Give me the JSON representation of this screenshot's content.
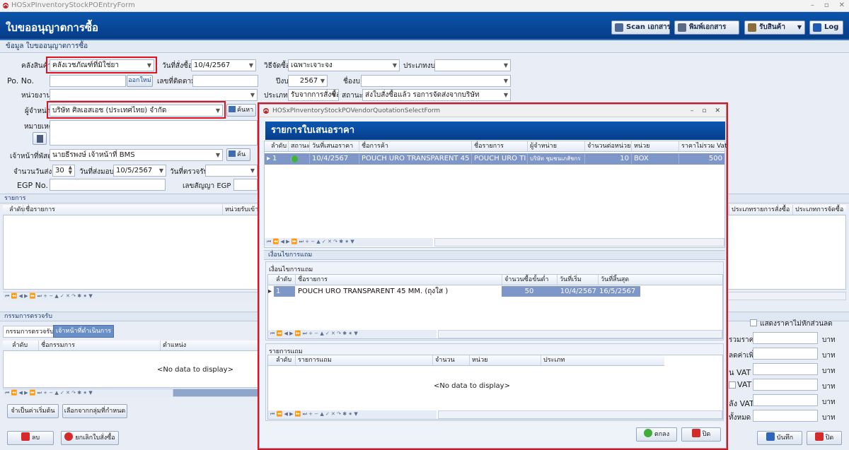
{
  "window": {
    "title": "HOSxPInventoryStockPOEntryForm",
    "btn_min": "–",
    "btn_max": "▫",
    "btn_close": "✕"
  },
  "header": {
    "title": "ใบขออนุญาตการซื้อ",
    "buttons": [
      {
        "label": "Scan เอกสาร"
      },
      {
        "label": "พิมพ์เอกสาร"
      },
      {
        "label": "รับสินค้า"
      },
      {
        "label": "Log"
      }
    ]
  },
  "subtab": "ข้อมูล ใบขออนุญาตการซื้อ",
  "form": {
    "warehouse_label": "คลังสินค้า",
    "warehouse_value": "คลังเวชภัณฑ์ที่มิใช่ยา",
    "order_date_label": "วันที่สั่งซื้อ",
    "order_date_value": "10/4/2567",
    "method_label": "วิธีจัดซื้อ",
    "method_value": "เฉพาะเจาะจง",
    "budget_type_label": "ประเภทงบ",
    "budget_type_value": "",
    "po_label": "Po. No.",
    "new_btn": "ออกใหม่",
    "track_label": "เลขที่ติดตาม",
    "year_label": "ปีงบ",
    "year_value": "2567",
    "budget_name_label": "ชื่องบ",
    "dept_label": "หน่วยงาน",
    "type_label": "ประเภท",
    "type_value": "รับจากการสั่งซื้อ",
    "status_label": "สถานะ",
    "status_value": "ส่งใบสั่งซื้อแล้ว รอการจัดส่งจากบริษัท",
    "vendor_label": "ผู้จำหน่าย",
    "vendor_value": "บริษัท ศิลเอสเอช (ประเทศไทย) จำกัด",
    "vendor_search": "ค้นหา",
    "remark_label": "หมายเหตุ",
    "officer_label": "เจ้าหน้าที่พัสดุ",
    "officer_value": "นายธีรพงษ์ เจ้าหน้าที่ BMS",
    "officer_search": "ค้น",
    "days_label": "จำนวนวันส่ง",
    "days_value": "30",
    "deliver_label": "วันที่ส่งมอบ",
    "deliver_value": "10/5/2567",
    "inspect_label": "วันที่ตรวจรับ",
    "egp_label": "EGP No.",
    "egp_contract_label": "เลขสัญญา EGP"
  },
  "items_panel": {
    "title": "รายการ",
    "col_no": "ลำดับ",
    "col_name": "ชื่อรายการ",
    "col_unit": "หน่วยรับเข้า",
    "col_ptype": "ประเภทรายการสั่งซื้อ",
    "col_buytype": "ประเภทการจัดซื้อ"
  },
  "committee": {
    "title": "กรรมการตรวจรับ",
    "tab1": "กรรมการตรวจรับ",
    "tab2": "เจ้าหน้าที่ดำเนินการ",
    "col_no": "ลำดับ",
    "col_name": "ชื่อกรรมการ",
    "col_pos": "ตำแหน่ง",
    "nodata": "<No data to display>",
    "btn_default": "จำเป็นค่าเริ่มต้น",
    "btn_group": "เลือกจากกลุ่มที่กำหนด"
  },
  "totals": {
    "novat_check": "แสดงราคาไม่หักส่วนลด",
    "l1": "รวมราคา",
    "l2": "ลดค่าเพิ่ม",
    "l3": "น VAT",
    "l4": "VAT",
    "l5": "ลัง VAT",
    "l6": "ทั้งหมด",
    "unit": "บาท"
  },
  "footer": {
    "delete": "ลบ",
    "cancel_po": "ยกเลิกใบสั่งซื้อ",
    "save": "บันทึก",
    "close": "ปิด"
  },
  "modal": {
    "title": "HOSxPInventoryStockPOVendorQuotationSelectForm",
    "heading": "รายการใบเสนอราคา",
    "q_cols": [
      "ลำดับ",
      "สถานะ",
      "วันที่เสนอราคา",
      "ชื่อการค้า",
      "ชื่อรายการ",
      "ผู้จำหน่าย",
      "จำนวนต่อหน่วย",
      "หน่วย",
      "ราคาไม่รวม Vat"
    ],
    "q_row": {
      "no": "1",
      "date": "10/4/2567",
      "trade": "POUCH URO TRANSPARENT 45",
      "item": "POUCH URO TI",
      "vendor": "บริษัท ชุมชนเภสัชกร",
      "qty": "10",
      "unit": "BOX",
      "price": "500"
    },
    "cond_outer": "เงื่อนไขการแถม",
    "cond_inner": "เงื่อนไขการแถม",
    "c_cols": [
      "ลำดับ",
      "ชื่อรายการ",
      "จำนวนซื้อขั้นต่ำ",
      "วันที่เริ่ม",
      "วันที่สิ้นสุด"
    ],
    "c_row": {
      "no": "1",
      "name": "POUCH URO TRANSPARENT 45 MM. (ถุงใส )",
      "min": "50",
      "start": "10/4/2567",
      "end": "16/5/2567"
    },
    "gift_title": "รายการแถม",
    "g_cols": [
      "ลำดับ",
      "รายการแถม",
      "จำนวน",
      "หน่วย",
      "ประเภท"
    ],
    "nodata": "<No data to display>",
    "ok": "ตกลง",
    "close": "ปิด"
  },
  "colors": {
    "brand": "#0b55ad",
    "highlight": "#e0121b",
    "selected_row": "#7f96c9"
  }
}
